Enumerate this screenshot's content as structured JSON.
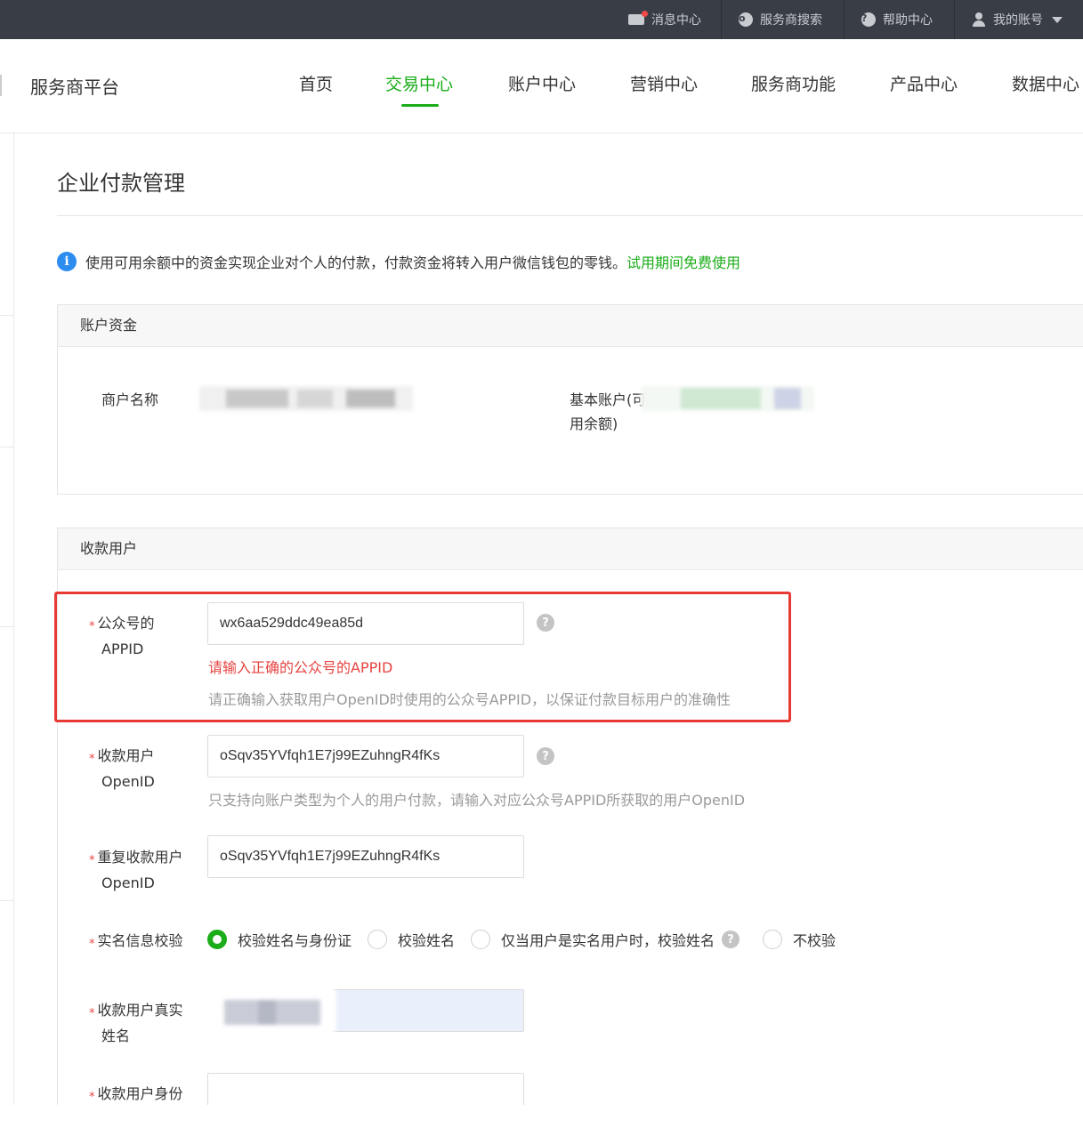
{
  "topbar": {
    "messages": "消息中心",
    "search": "服务商搜索",
    "help": "帮助中心",
    "account": "我的账号"
  },
  "nav": {
    "brand": "服务商平台",
    "items": [
      "首页",
      "交易中心",
      "账户中心",
      "营销中心",
      "服务商功能",
      "产品中心",
      "数据中心"
    ],
    "active_index": 1
  },
  "page": {
    "title": "企业付款管理",
    "notice": "使用可用余额中的资金实现企业对个人的付款，付款资金将转入用户微信钱包的零钱。",
    "notice_link": "试用期间免费使用"
  },
  "account_panel": {
    "header": "账户资金",
    "merchant_label": "商户名称",
    "balance_label_line1": "基本账户(可",
    "balance_label_line2": "用余额)"
  },
  "payee_panel": {
    "header": "收款用户",
    "required_mark": "*",
    "appid": {
      "label_line1": "公众号的",
      "label_line2": "APPID",
      "value": "wx6aa529ddc49ea85d",
      "error": "请输入正确的公众号的APPID",
      "tip": "请正确输入获取用户OpenID时使用的公众号APPID，以保证付款目标用户的准确性"
    },
    "openid": {
      "label_line1": "收款用户",
      "label_line2": "OpenID",
      "value": "oSqv35YVfqh1E7j99EZuhngR4fKs",
      "tip": "只支持向账户类型为个人的用户付款，请输入对应公众号APPID所获取的用户OpenID"
    },
    "openid_repeat": {
      "label_line1": "重复收款用户",
      "label_line2": "OpenID",
      "value": "oSqv35YVfqh1E7j99EZuhngR4fKs"
    },
    "verify": {
      "label": "实名信息校验",
      "options": [
        "校验姓名与身份证",
        "校验姓名",
        "仅当用户是实名用户时，校验姓名",
        "不校验"
      ],
      "selected_index": 0
    },
    "real_name": {
      "label_line1": "收款用户真实",
      "label_line2": "姓名"
    },
    "id_card": {
      "label_line1": "收款用户身份"
    }
  }
}
